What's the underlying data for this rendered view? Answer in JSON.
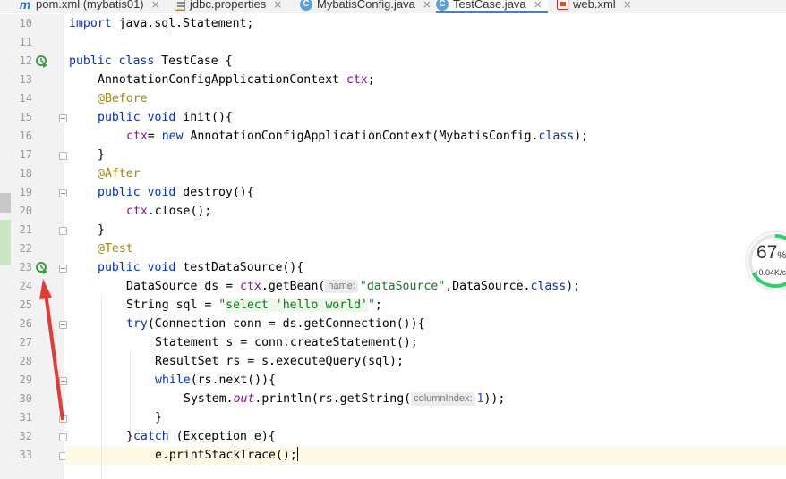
{
  "tabs": [
    {
      "icon": "maven-icon",
      "label": "pom.xml (mybatis01)",
      "active": false,
      "close": true
    },
    {
      "icon": "properties-file-icon",
      "label": "jdbc.properties",
      "active": false,
      "close": true
    },
    {
      "icon": "java-class-icon",
      "label": "MybatisConfig.java",
      "active": false,
      "close": true
    },
    {
      "icon": "java-class-icon",
      "label": "TestCase.java",
      "active": true,
      "close": true
    },
    {
      "icon": "xml-file-icon",
      "label": "web.xml",
      "active": false,
      "close": true
    }
  ],
  "tab_close_glyph": "×",
  "class_icon_letter": "C",
  "maven_icon_letter": "m",
  "line_numbers": [
    "10",
    "11",
    "12",
    "13",
    "14",
    "15",
    "16",
    "17",
    "18",
    "19",
    "20",
    "21",
    "22",
    "23",
    "24",
    "25",
    "26",
    "27",
    "28",
    "29",
    "30",
    "31",
    "32",
    "33"
  ],
  "code": {
    "l10": [
      "import",
      " java.sql.Statement;"
    ],
    "l12": [
      "public class",
      " TestCase {"
    ],
    "l13": [
      "AnnotationConfigApplicationContext ",
      "ctx",
      ";"
    ],
    "l14": [
      "@Before"
    ],
    "l15": [
      "public void",
      " init(){"
    ],
    "l16": [
      "ctx",
      "= ",
      "new",
      " AnnotationConfigApplicationContext(MybatisConfig.",
      "class",
      ");"
    ],
    "l17": [
      "}"
    ],
    "l18": [
      "@After"
    ],
    "l19": [
      "public void",
      " destroy(){"
    ],
    "l20": [
      "ctx",
      ".close();"
    ],
    "l21": [
      "}"
    ],
    "l22": [
      "@Test"
    ],
    "l23": [
      "public void",
      " testDataSource(){"
    ],
    "l24": [
      "DataSource ds = ",
      "ctx",
      ".getBean(",
      "name:",
      "\"dataSource\"",
      ",DataSource.",
      "class",
      ");"
    ],
    "l25": [
      "String sql = ",
      "\"",
      "select 'hello world'",
      "\"",
      ";"
    ],
    "l26": [
      "try",
      "(Connection conn = ds.getConnection()){"
    ],
    "l27": [
      "Statement s = conn.createStatement();"
    ],
    "l28": [
      "ResultSet rs = s.executeQuery(sql);"
    ],
    "l29": [
      "while",
      "(rs.next()){"
    ],
    "l30": [
      "System.",
      "out",
      ".println(rs.getString(",
      "columnIndex:",
      "1",
      "));"
    ],
    "l31": [
      "}"
    ],
    "l32": [
      "}",
      "catch",
      " (Exception e){"
    ],
    "l33": [
      "e.printStackTrace();"
    ]
  },
  "speed_widget": {
    "percent": "67",
    "percent_sign": "%",
    "percent_value": 67,
    "up_arrow": "↑",
    "rate": "0.04K/s"
  },
  "colors": {
    "keyword": "#0033b3",
    "annotation": "#9e880d",
    "string": "#067d17",
    "field": "#871094",
    "number": "#1750eb",
    "active_tab_underline": "#4083c9",
    "run_icon": "#3a9b43",
    "red_arrow": "#e53935",
    "speed_ring": "#2bd36b"
  }
}
